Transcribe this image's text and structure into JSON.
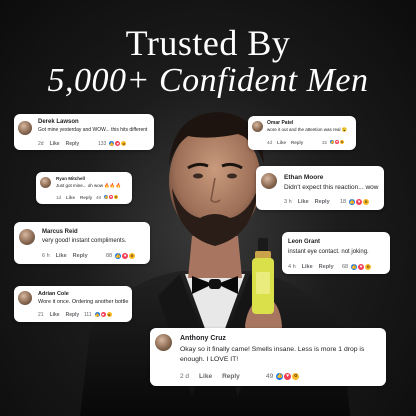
{
  "headline": {
    "line1": "Trusted By",
    "line2": "5,000+ Confident Men"
  },
  "icons": {
    "like": "thumbs-up-icon",
    "love": "heart-icon",
    "wow": "wow-face-icon"
  },
  "colors": {
    "like": "#1877f2",
    "love": "#f33e58",
    "wow": "#f7b928",
    "serum": "#d9e04a",
    "background": "#141414"
  },
  "comments": [
    {
      "name": "Derek Lawson",
      "text": "Got mine yesterday and WOW... this hits different",
      "time": "2d",
      "like": "Like",
      "reply": "Reply",
      "count": "133"
    },
    {
      "name": "Omar Patel",
      "text": "wore it out and the attention was real 😮",
      "time": "4d",
      "like": "Like",
      "reply": "Reply",
      "count": "32"
    },
    {
      "name": "Ryan Mitchell",
      "text": "Just got mine... oh wow 🔥🔥🔥",
      "time": "1d",
      "like": "Like",
      "reply": "Reply",
      "count": "48"
    },
    {
      "name": "Ethan Moore",
      "text": "Didn't expect this reaction... wow",
      "time": "3 h",
      "like": "Like",
      "reply": "Reply",
      "count": "18"
    },
    {
      "name": "Marcus Reid",
      "text": "very good! instant compliments.",
      "time": "6 h",
      "like": "Like",
      "reply": "Reply",
      "count": "88"
    },
    {
      "name": "Leon Grant",
      "text": "instant eye contact. not joking.",
      "time": "4 h",
      "like": "Like",
      "reply": "Reply",
      "count": "68"
    },
    {
      "name": "Adrian Cole",
      "text": "Wore it once. Ordering another bottle",
      "time": "21",
      "like": "Like",
      "reply": "Reply",
      "count": "111"
    },
    {
      "name": "Anthony Cruz",
      "text": "Okay so it finally came! Smells insane. Less is more 1 drop is",
      "text2": "enough. I LOVE IT!",
      "time": "2 d",
      "like": "Like",
      "reply": "Reply",
      "count": "49"
    }
  ]
}
